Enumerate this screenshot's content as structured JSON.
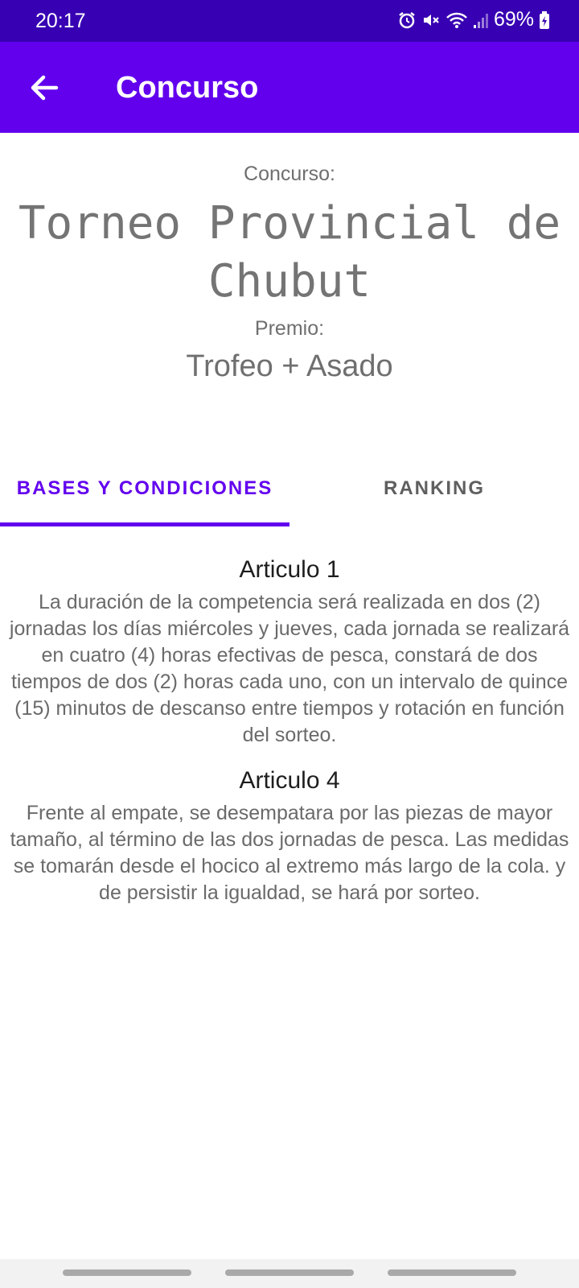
{
  "status_bar": {
    "time": "20:17",
    "battery": "69%",
    "icons": [
      "alarm-icon",
      "mute-icon",
      "wifi-icon",
      "signal-icon",
      "battery-icon"
    ]
  },
  "app_bar": {
    "title": "Concurso",
    "back_icon": "arrow-back-icon",
    "color": "#6200ee"
  },
  "contest": {
    "label": "Concurso:",
    "name": "Torneo Provincial de Chubut",
    "prize_label": "Premio:",
    "prize_value": "Trofeo + Asado"
  },
  "tabs": [
    {
      "label": "BASES Y CONDICIONES",
      "selected": true
    },
    {
      "label": "RANKING",
      "selected": false
    }
  ],
  "articles": [
    {
      "title": "Articulo 1",
      "body": "La duración de la competencia será realizada en dos (2) jornadas los días miércoles y jueves, cada jornada se realizará en cuatro (4) horas efectivas de pesca, constará de dos tiempos de dos (2) horas cada uno, con un intervalo de quince (15) minutos de descanso entre tiempos y rotación en función del sorteo."
    },
    {
      "title": "Articulo 4",
      "body": "Frente al empate, se desempatara por las piezas de mayor tamaño, al término de las dos jornadas de pesca. Las medidas se tomarán desde el hocico al extremo más largo de la cola. y de persistir la igualdad, se hará por sorteo."
    }
  ],
  "colors": {
    "status_bar": "#3700b3",
    "primary": "#6200ee",
    "tab_unselected": "#5f5f5f"
  }
}
